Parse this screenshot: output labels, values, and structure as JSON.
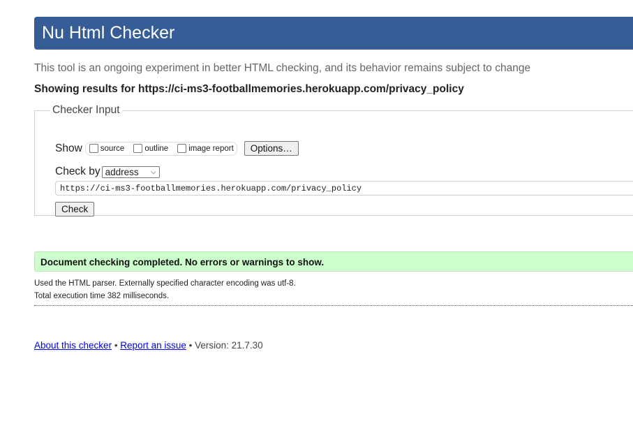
{
  "header": {
    "title": "Nu Html Checker"
  },
  "tagline": "This tool is an ongoing experiment in better HTML checking, and its behavior remains subject to change",
  "results_for": {
    "prefix": "Showing results for ",
    "url": "https://ci-ms3-footballmemories.herokuapp.com/privacy_policy"
  },
  "checker_input": {
    "legend": "Checker Input",
    "show_label": "Show",
    "options": [
      {
        "label": "source",
        "checked": false
      },
      {
        "label": "outline",
        "checked": false
      },
      {
        "label": "image report",
        "checked": false
      }
    ],
    "options_button": "Options…",
    "check_by_label": "Check by",
    "check_by_value": "address",
    "url_value": "https://ci-ms3-footballmemories.herokuapp.com/privacy_policy",
    "check_button": "Check"
  },
  "result": {
    "message": "Document checking completed. No errors or warnings to show.",
    "details": [
      "Used the HTML parser. Externally specified character encoding was utf-8.",
      "Total execution time 382 milliseconds."
    ]
  },
  "footer": {
    "about_link": "About this checker",
    "separator": " • ",
    "report_link": "Report an issue",
    "version": "Version: 21.7.30"
  },
  "colors": {
    "header_bg": "#365d95",
    "success_bg": "#ccffcc",
    "link": "#0000ee"
  }
}
